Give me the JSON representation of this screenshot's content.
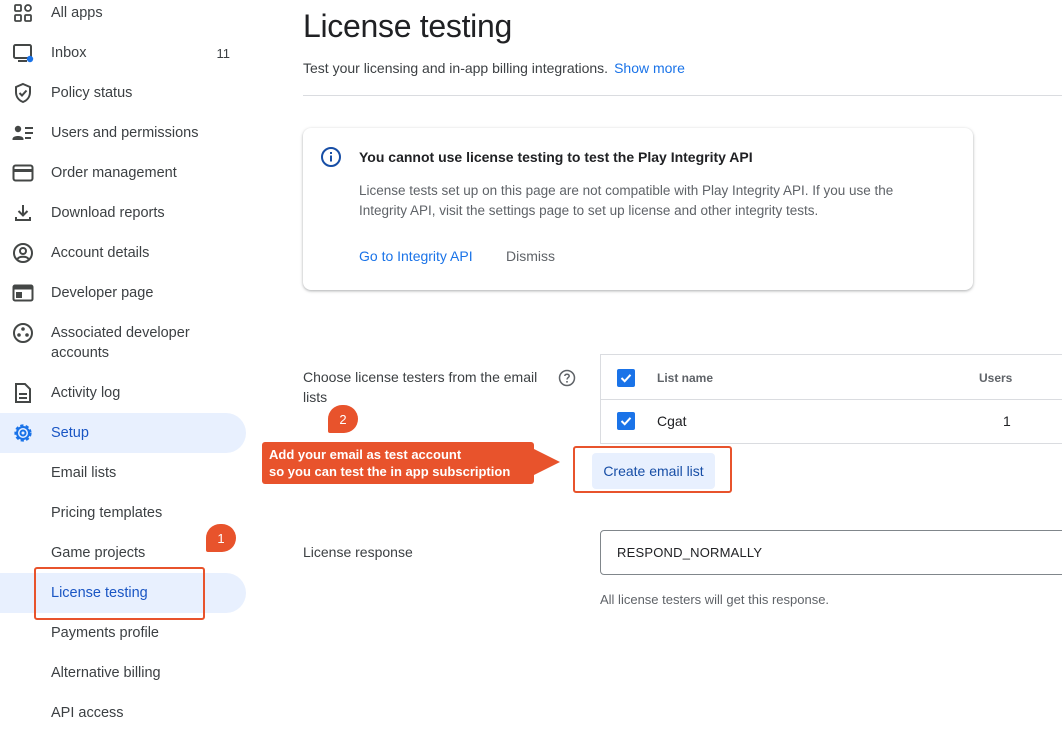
{
  "sidebar": {
    "items": [
      {
        "label": "All apps",
        "icon": "grid-icon"
      },
      {
        "label": "Inbox",
        "icon": "inbox-icon",
        "count": "11"
      },
      {
        "label": "Policy status",
        "icon": "shield-icon"
      },
      {
        "label": "Users and permissions",
        "icon": "users-icon"
      },
      {
        "label": "Order management",
        "icon": "credit-card-icon"
      },
      {
        "label": "Download reports",
        "icon": "download-icon"
      },
      {
        "label": "Account details",
        "icon": "account-circle-icon"
      },
      {
        "label": "Developer page",
        "icon": "web-page-icon"
      },
      {
        "label": "Associated developer accounts",
        "icon": "associated-accounts-icon"
      },
      {
        "label": "Activity log",
        "icon": "document-icon"
      },
      {
        "label": "Setup",
        "icon": "gear-icon"
      }
    ],
    "setup_children": [
      {
        "label": "Email lists"
      },
      {
        "label": "Pricing templates"
      },
      {
        "label": "Game projects"
      },
      {
        "label": "License testing"
      },
      {
        "label": "Payments profile"
      },
      {
        "label": "Alternative billing"
      },
      {
        "label": "API access"
      }
    ]
  },
  "main": {
    "title": "License testing",
    "subtitle": "Test your licensing and in-app billing integrations.",
    "show_more": "Show more",
    "info_card": {
      "title": "You cannot use license testing to test the Play Integrity API",
      "body": "License tests set up on this page are not compatible with Play Integrity API. If you use the Integrity API, visit the settings page to set up license and other integrity tests.",
      "primary_link": "Go to Integrity API",
      "dismiss": "Dismiss"
    },
    "testers": {
      "label": "Choose license testers from the email lists",
      "columns": {
        "list_name": "List name",
        "users": "Users"
      },
      "rows": [
        {
          "name": "Cgat",
          "users": "1",
          "checked": true
        }
      ],
      "create_button": "Create email list"
    },
    "license_response": {
      "label": "License response",
      "value": "RESPOND_NORMALLY",
      "hint": "All license testers will get this response."
    }
  },
  "annotations": {
    "step1": "1",
    "step2": "2",
    "callout_line1": "Add your email as test account",
    "callout_line2": "so you can test the in app subscription",
    "accent_color": "#e8532c"
  }
}
